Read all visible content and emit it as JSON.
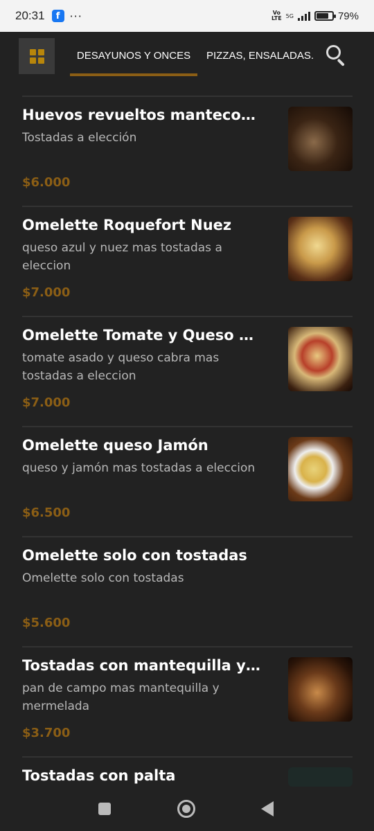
{
  "status_bar": {
    "time": "20:31",
    "app_icon": "facebook-icon",
    "more": "···",
    "volte_top": "Vo",
    "volte_bottom": "LTE",
    "network": "5G",
    "battery_level": 0.79,
    "battery_text": "79%"
  },
  "top_nav": {
    "menu_icon": "grid-icon",
    "tabs": [
      {
        "label": "DESAYUNOS Y ONCES",
        "active": true
      },
      {
        "label": "PIZZAS, ENSALADAS.",
        "active": false
      }
    ],
    "search_icon": "search-icon",
    "accent_color": "#8b5e15"
  },
  "menu_items": [
    {
      "name": "Huevos revueltos mantecos...",
      "description": "Tostadas a elección",
      "price": "$6.000",
      "has_image": true
    },
    {
      "name": "Omelette Roquefort Nuez",
      "description": "queso azul y nuez mas tostadas a eleccion",
      "price": "$7.000",
      "has_image": true
    },
    {
      "name": "Omelette Tomate y Queso d...",
      "description": "tomate asado y queso cabra mas tostadas a eleccion",
      "price": "$7.000",
      "has_image": true
    },
    {
      "name": "Omelette queso Jamón",
      "description": "queso y jamón mas tostadas a eleccion",
      "price": "$6.500",
      "has_image": true
    },
    {
      "name": "Omelette solo con tostadas",
      "description": "Omelette solo con tostadas",
      "price": "$5.600",
      "has_image": false
    },
    {
      "name": "Tostadas con mantequilla y ...",
      "description": "pan de campo mas mantequilla y mermelada",
      "price": "$3.700",
      "has_image": true
    },
    {
      "name": "Tostadas con palta",
      "description": "",
      "price": "",
      "has_image": true
    }
  ],
  "nav_bar": {
    "recents_icon": "square-icon",
    "home_icon": "circle-icon",
    "back_icon": "triangle-back-icon"
  }
}
